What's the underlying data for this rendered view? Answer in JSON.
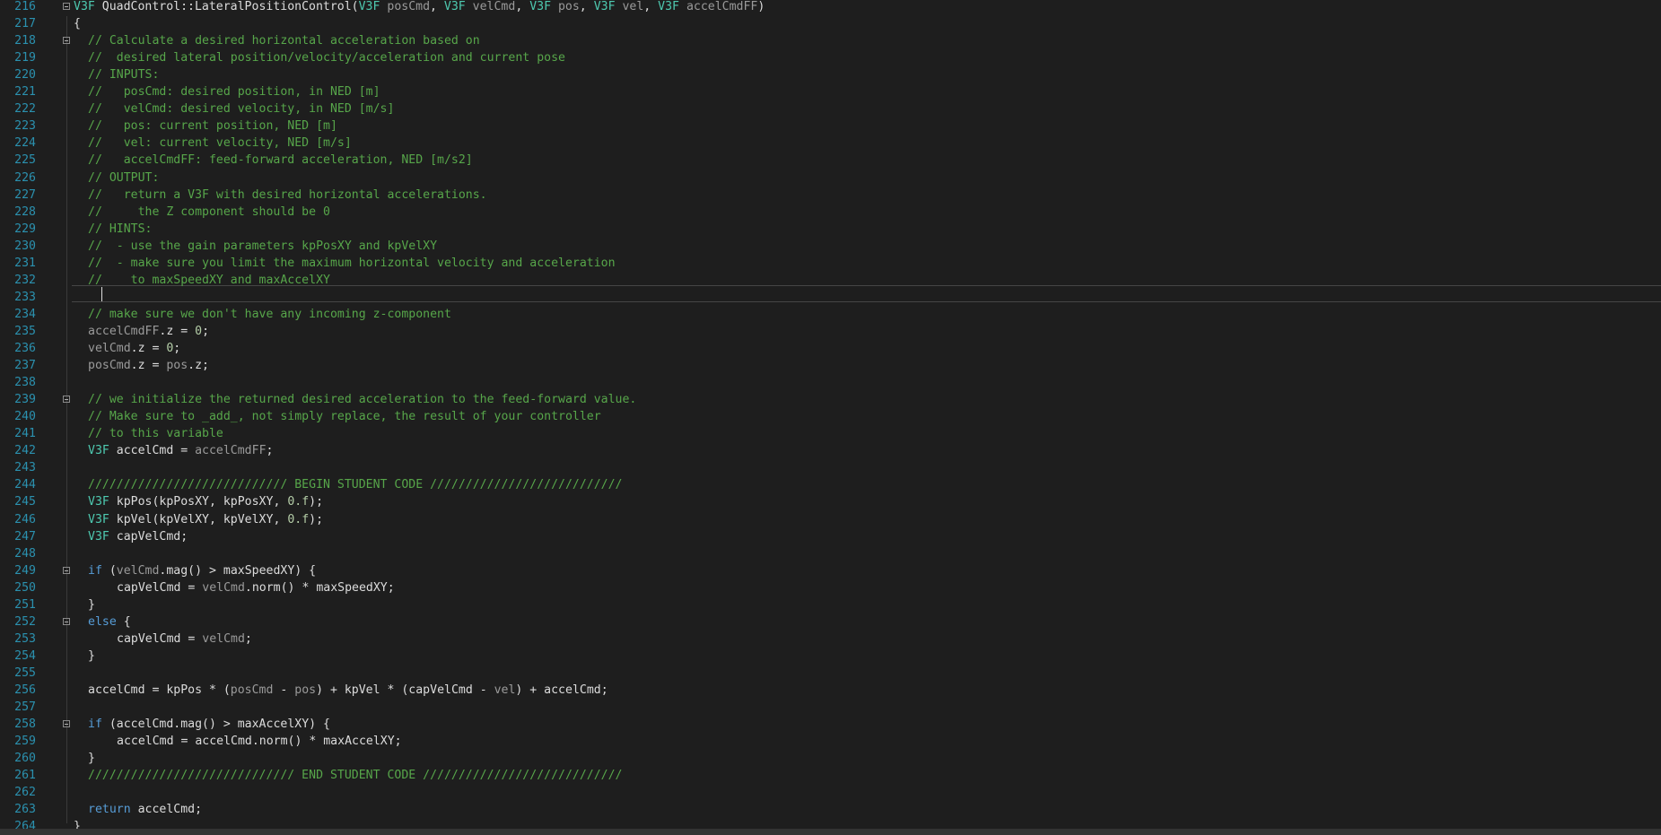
{
  "lines": [
    {
      "n": "216",
      "fold": true,
      "indent": "top",
      "parts": [
        {
          "t": "V3F",
          "c": "c-type"
        },
        {
          "t": " QuadControl::",
          "c": "c-plain"
        },
        {
          "t": "LateralPositionControl",
          "c": "c-plain"
        },
        {
          "t": "(",
          "c": "c-plain"
        },
        {
          "t": "V3F",
          "c": "c-type"
        },
        {
          "t": " posCmd",
          "c": "c-param"
        },
        {
          "t": ", ",
          "c": "c-plain"
        },
        {
          "t": "V3F",
          "c": "c-type"
        },
        {
          "t": " velCmd",
          "c": "c-param"
        },
        {
          "t": ", ",
          "c": "c-plain"
        },
        {
          "t": "V3F",
          "c": "c-type"
        },
        {
          "t": " pos",
          "c": "c-param"
        },
        {
          "t": ", ",
          "c": "c-plain"
        },
        {
          "t": "V3F",
          "c": "c-type"
        },
        {
          "t": " vel",
          "c": "c-param"
        },
        {
          "t": ", ",
          "c": "c-plain"
        },
        {
          "t": "V3F",
          "c": "c-type"
        },
        {
          "t": " accelCmdFF",
          "c": "c-param"
        },
        {
          "t": ")",
          "c": "c-plain"
        }
      ]
    },
    {
      "n": "217",
      "indent": "top",
      "parts": [
        {
          "t": "{",
          "c": "c-plain"
        }
      ]
    },
    {
      "n": "218",
      "fold": true,
      "indent": "indent",
      "parts": [
        {
          "t": "// Calculate a desired horizontal acceleration based on",
          "c": "c-com"
        }
      ]
    },
    {
      "n": "219",
      "indent": "indent",
      "parts": [
        {
          "t": "//  desired lateral position/velocity/acceleration and current pose",
          "c": "c-com"
        }
      ]
    },
    {
      "n": "220",
      "indent": "indent",
      "parts": [
        {
          "t": "// INPUTS:",
          "c": "c-com"
        }
      ]
    },
    {
      "n": "221",
      "indent": "indent",
      "parts": [
        {
          "t": "//   posCmd: desired position, in NED [m]",
          "c": "c-com"
        }
      ]
    },
    {
      "n": "222",
      "indent": "indent",
      "parts": [
        {
          "t": "//   velCmd: desired velocity, in NED [m/s]",
          "c": "c-com"
        }
      ]
    },
    {
      "n": "223",
      "indent": "indent",
      "parts": [
        {
          "t": "//   pos: current position, NED [m]",
          "c": "c-com"
        }
      ]
    },
    {
      "n": "224",
      "indent": "indent",
      "parts": [
        {
          "t": "//   vel: current velocity, NED [m/s]",
          "c": "c-com"
        }
      ]
    },
    {
      "n": "225",
      "indent": "indent",
      "parts": [
        {
          "t": "//   accelCmdFF: feed-forward acceleration, NED [m/s2]",
          "c": "c-com"
        }
      ]
    },
    {
      "n": "226",
      "indent": "indent",
      "parts": [
        {
          "t": "// OUTPUT:",
          "c": "c-com"
        }
      ]
    },
    {
      "n": "227",
      "indent": "indent",
      "parts": [
        {
          "t": "//   return a V3F with desired horizontal accelerations.",
          "c": "c-com"
        }
      ]
    },
    {
      "n": "228",
      "indent": "indent",
      "parts": [
        {
          "t": "//     the Z component should be 0",
          "c": "c-com"
        }
      ]
    },
    {
      "n": "229",
      "indent": "indent",
      "parts": [
        {
          "t": "// HINTS:",
          "c": "c-com"
        }
      ]
    },
    {
      "n": "230",
      "indent": "indent",
      "parts": [
        {
          "t": "//  - use the gain parameters kpPosXY and kpVelXY",
          "c": "c-com"
        }
      ]
    },
    {
      "n": "231",
      "indent": "indent",
      "parts": [
        {
          "t": "//  - make sure you limit the maximum horizontal velocity and acceleration",
          "c": "c-com"
        }
      ]
    },
    {
      "n": "232",
      "indent": "indent",
      "parts": [
        {
          "t": "//    to maxSpeedXY and maxAccelXY",
          "c": "c-com"
        }
      ]
    },
    {
      "n": "233",
      "indent": "indent",
      "parts": []
    },
    {
      "n": "234",
      "indent": "indent",
      "parts": [
        {
          "t": "// make sure we don't have any incoming z-component",
          "c": "c-com"
        }
      ]
    },
    {
      "n": "235",
      "indent": "indent",
      "parts": [
        {
          "t": "accelCmdFF",
          "c": "c-param"
        },
        {
          "t": ".z = ",
          "c": "c-plain"
        },
        {
          "t": "0",
          "c": "c-num"
        },
        {
          "t": ";",
          "c": "c-plain"
        }
      ]
    },
    {
      "n": "236",
      "indent": "indent",
      "parts": [
        {
          "t": "velCmd",
          "c": "c-param"
        },
        {
          "t": ".z = ",
          "c": "c-plain"
        },
        {
          "t": "0",
          "c": "c-num"
        },
        {
          "t": ";",
          "c": "c-plain"
        }
      ]
    },
    {
      "n": "237",
      "indent": "indent",
      "parts": [
        {
          "t": "posCmd",
          "c": "c-param"
        },
        {
          "t": ".z = ",
          "c": "c-plain"
        },
        {
          "t": "pos",
          "c": "c-param"
        },
        {
          "t": ".z;",
          "c": "c-plain"
        }
      ]
    },
    {
      "n": "238",
      "indent": "indent",
      "parts": []
    },
    {
      "n": "239",
      "fold": true,
      "indent": "indent",
      "parts": [
        {
          "t": "// we initialize the returned desired acceleration to the feed-forward value.",
          "c": "c-com"
        }
      ]
    },
    {
      "n": "240",
      "indent": "indent",
      "parts": [
        {
          "t": "// Make sure to _add_, not simply replace, the result of your controller",
          "c": "c-com"
        }
      ]
    },
    {
      "n": "241",
      "indent": "indent",
      "parts": [
        {
          "t": "// to this variable",
          "c": "c-com"
        }
      ]
    },
    {
      "n": "242",
      "indent": "indent",
      "parts": [
        {
          "t": "V3F",
          "c": "c-type"
        },
        {
          "t": " accelCmd = ",
          "c": "c-plain"
        },
        {
          "t": "accelCmdFF",
          "c": "c-param"
        },
        {
          "t": ";",
          "c": "c-plain"
        }
      ]
    },
    {
      "n": "243",
      "indent": "indent",
      "parts": []
    },
    {
      "n": "244",
      "indent": "indent",
      "parts": [
        {
          "t": "//////////////////////////// BEGIN STUDENT CODE ///////////////////////////",
          "c": "c-com"
        }
      ]
    },
    {
      "n": "245",
      "indent": "indent",
      "parts": [
        {
          "t": "V3F",
          "c": "c-type"
        },
        {
          "t": " kpPos(kpPosXY, kpPosXY, ",
          "c": "c-plain"
        },
        {
          "t": "0.f",
          "c": "c-num"
        },
        {
          "t": ");",
          "c": "c-plain"
        }
      ]
    },
    {
      "n": "246",
      "indent": "indent",
      "parts": [
        {
          "t": "V3F",
          "c": "c-type"
        },
        {
          "t": " kpVel(kpVelXY, kpVelXY, ",
          "c": "c-plain"
        },
        {
          "t": "0.f",
          "c": "c-num"
        },
        {
          "t": ");",
          "c": "c-plain"
        }
      ]
    },
    {
      "n": "247",
      "indent": "indent",
      "parts": [
        {
          "t": "V3F",
          "c": "c-type"
        },
        {
          "t": " capVelCmd;",
          "c": "c-plain"
        }
      ]
    },
    {
      "n": "248",
      "indent": "indent",
      "parts": []
    },
    {
      "n": "249",
      "fold": true,
      "indent": "indent",
      "parts": [
        {
          "t": "if",
          "c": "c-kw"
        },
        {
          "t": " (",
          "c": "c-plain"
        },
        {
          "t": "velCmd",
          "c": "c-param"
        },
        {
          "t": ".mag() > maxSpeedXY) {",
          "c": "c-plain"
        }
      ]
    },
    {
      "n": "250",
      "indent": "indent2",
      "parts": [
        {
          "t": "capVelCmd = ",
          "c": "c-plain"
        },
        {
          "t": "velCmd",
          "c": "c-param"
        },
        {
          "t": ".norm() * maxSpeedXY;",
          "c": "c-plain"
        }
      ]
    },
    {
      "n": "251",
      "indent": "indent",
      "parts": [
        {
          "t": "}",
          "c": "c-plain"
        }
      ]
    },
    {
      "n": "252",
      "fold": true,
      "indent": "indent",
      "parts": [
        {
          "t": "else",
          "c": "c-kw"
        },
        {
          "t": " {",
          "c": "c-plain"
        }
      ]
    },
    {
      "n": "253",
      "indent": "indent2",
      "parts": [
        {
          "t": "capVelCmd = ",
          "c": "c-plain"
        },
        {
          "t": "velCmd",
          "c": "c-param"
        },
        {
          "t": ";",
          "c": "c-plain"
        }
      ]
    },
    {
      "n": "254",
      "indent": "indent",
      "parts": [
        {
          "t": "}",
          "c": "c-plain"
        }
      ]
    },
    {
      "n": "255",
      "indent": "indent",
      "parts": []
    },
    {
      "n": "256",
      "indent": "indent",
      "parts": [
        {
          "t": "accelCmd = kpPos * (",
          "c": "c-plain"
        },
        {
          "t": "posCmd",
          "c": "c-param"
        },
        {
          "t": " - ",
          "c": "c-plain"
        },
        {
          "t": "pos",
          "c": "c-param"
        },
        {
          "t": ") + kpVel * (capVelCmd - ",
          "c": "c-plain"
        },
        {
          "t": "vel",
          "c": "c-param"
        },
        {
          "t": ") + accelCmd;",
          "c": "c-plain"
        }
      ]
    },
    {
      "n": "257",
      "indent": "indent",
      "parts": []
    },
    {
      "n": "258",
      "fold": true,
      "indent": "indent",
      "parts": [
        {
          "t": "if",
          "c": "c-kw"
        },
        {
          "t": " (accelCmd.mag() > maxAccelXY) {",
          "c": "c-plain"
        }
      ]
    },
    {
      "n": "259",
      "indent": "indent2",
      "parts": [
        {
          "t": "accelCmd = accelCmd.norm() * maxAccelXY;",
          "c": "c-plain"
        }
      ]
    },
    {
      "n": "260",
      "indent": "indent",
      "parts": [
        {
          "t": "}",
          "c": "c-plain"
        }
      ]
    },
    {
      "n": "261",
      "indent": "indent",
      "parts": [
        {
          "t": "///////////////////////////// END STUDENT CODE ////////////////////////////",
          "c": "c-com"
        }
      ]
    },
    {
      "n": "262",
      "indent": "indent",
      "parts": []
    },
    {
      "n": "263",
      "indent": "indent",
      "parts": [
        {
          "t": "return",
          "c": "c-kw"
        },
        {
          "t": " accelCmd;",
          "c": "c-plain"
        }
      ]
    },
    {
      "n": "264",
      "indent": "top",
      "parts": [
        {
          "t": "}",
          "c": "c-plain"
        }
      ]
    }
  ]
}
